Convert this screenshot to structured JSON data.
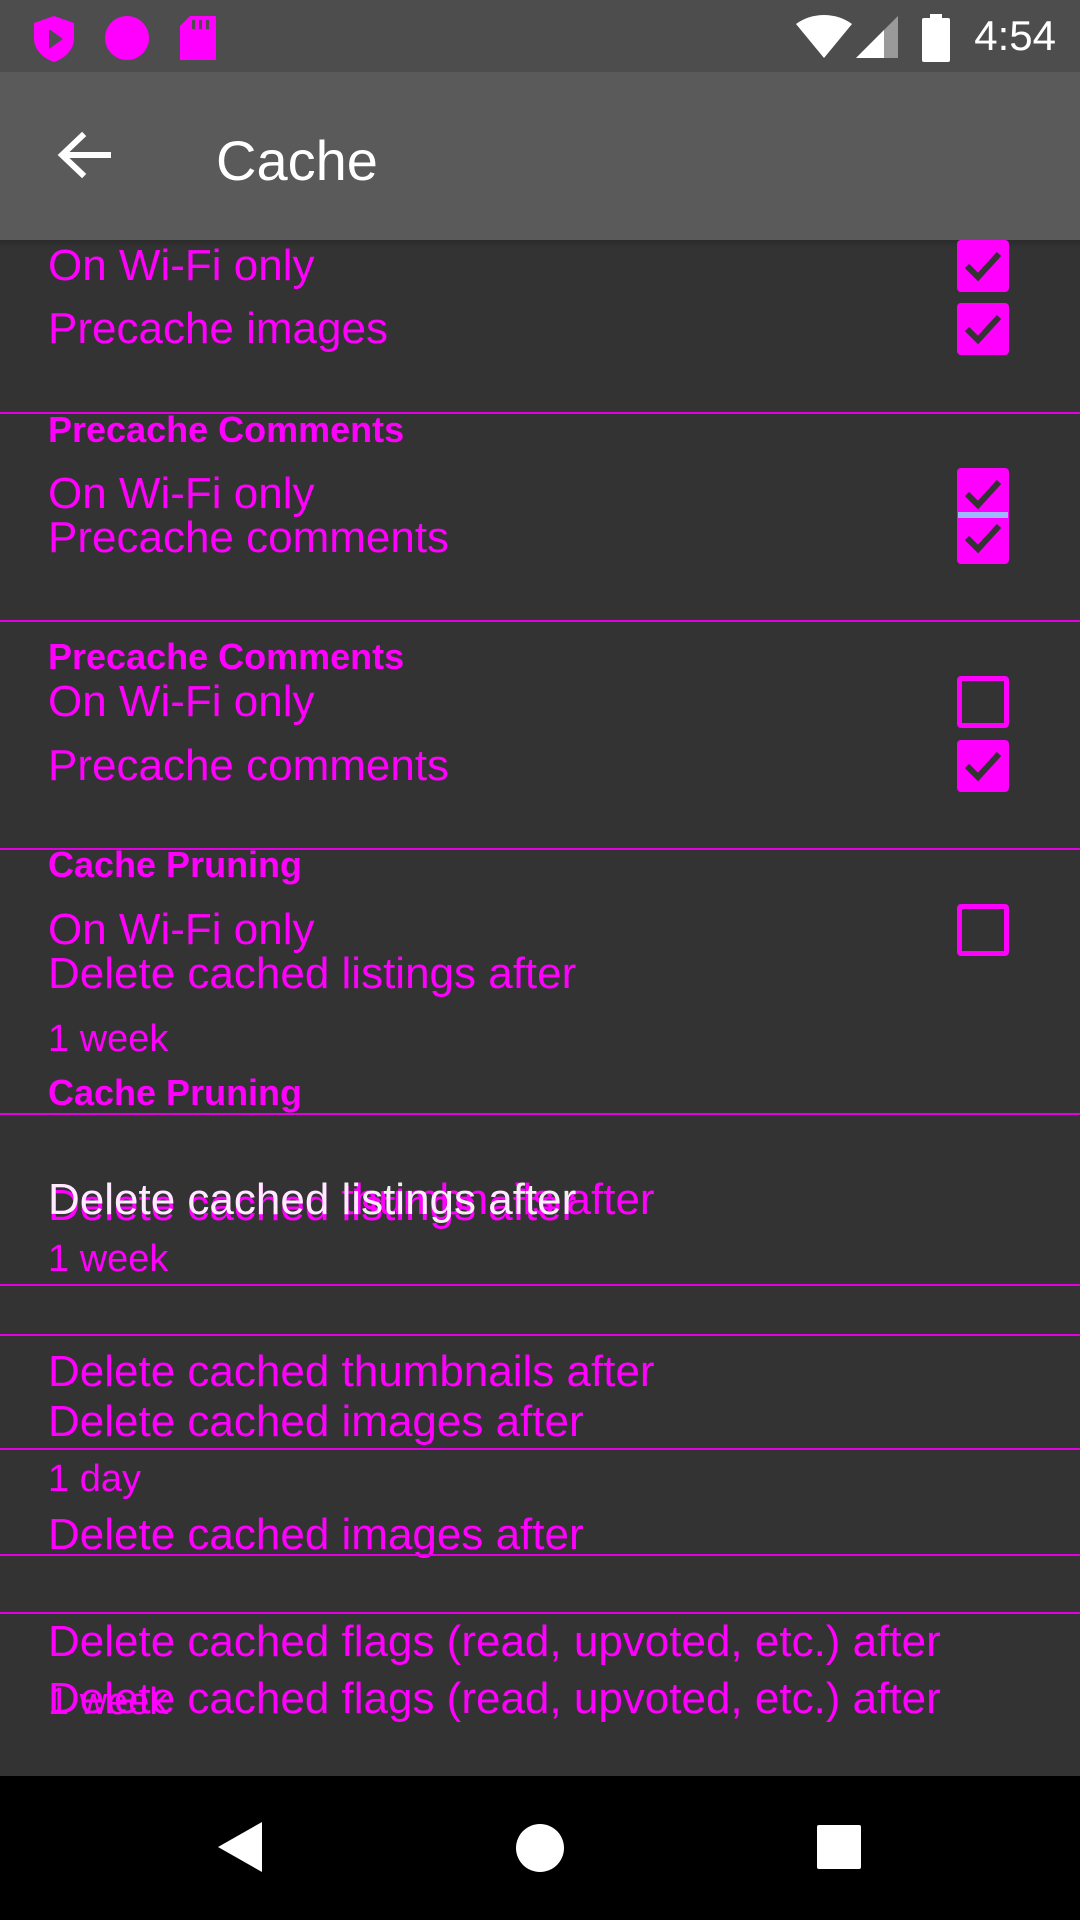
{
  "status_bar": {
    "time": "4:54",
    "icons": [
      "shield-play-icon",
      "circle-icon",
      "sd-card-icon",
      "wifi-icon",
      "signal-icon",
      "battery-icon"
    ]
  },
  "app_bar": {
    "title": "Cache",
    "back_icon": "arrow-back-icon"
  },
  "colors": {
    "accent": "#ff00ff",
    "background": "#333333",
    "app_bar": "#5a5a5a",
    "status_bar": "#4d4d4d",
    "nav_bar": "#000000"
  },
  "settings": {
    "wifi_only": "On Wi-Fi only",
    "precache_images": "Precache images",
    "precache_comments_category": "Precache Comments",
    "precache_comments": "Precache comments",
    "cache_pruning_category": "Cache Pruning",
    "delete_listings": "Delete cached listings after",
    "delete_thumbnails": "Delete cached thumbnails after",
    "delete_images": "Delete cached images after",
    "delete_flags": "Delete cached flags (read, upvoted, etc.) after",
    "one_week": "1 week",
    "one_day": "1 day"
  },
  "nav_bar": {
    "back_icon": "nav-back-icon",
    "home_icon": "nav-home-icon",
    "recents_icon": "nav-recents-icon"
  }
}
